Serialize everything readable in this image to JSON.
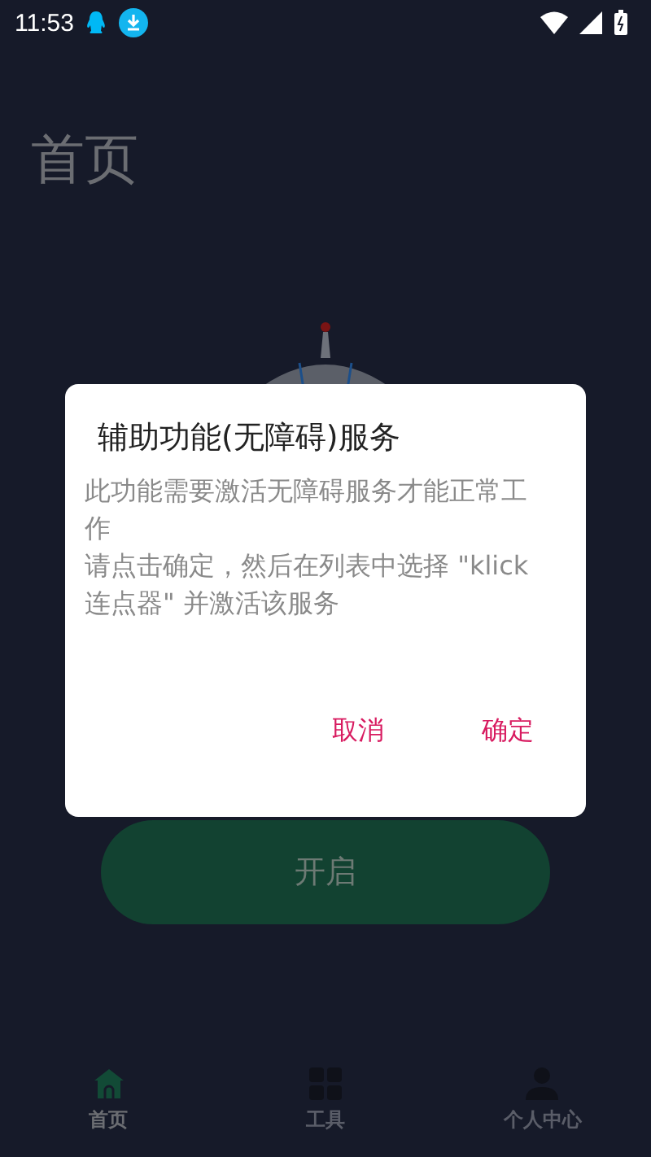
{
  "status_bar": {
    "time": "11:53"
  },
  "page": {
    "title": "首页",
    "start_button": "开启"
  },
  "dialog": {
    "title": "辅助功能(无障碍)服务",
    "message": [
      "此功能需要激活无障碍服务才能正常工作",
      "请点击确定，然后在列表中选择 \"klick连点器\" 并激活该服务"
    ],
    "buttons": [
      "取消",
      "确定"
    ]
  },
  "bottom_nav": [
    {
      "label": "首页",
      "kind": "home",
      "selected": true
    },
    {
      "label": "工具",
      "kind": "tools",
      "selected": false
    },
    {
      "label": "个人中心",
      "kind": "profile",
      "selected": false
    }
  ]
}
